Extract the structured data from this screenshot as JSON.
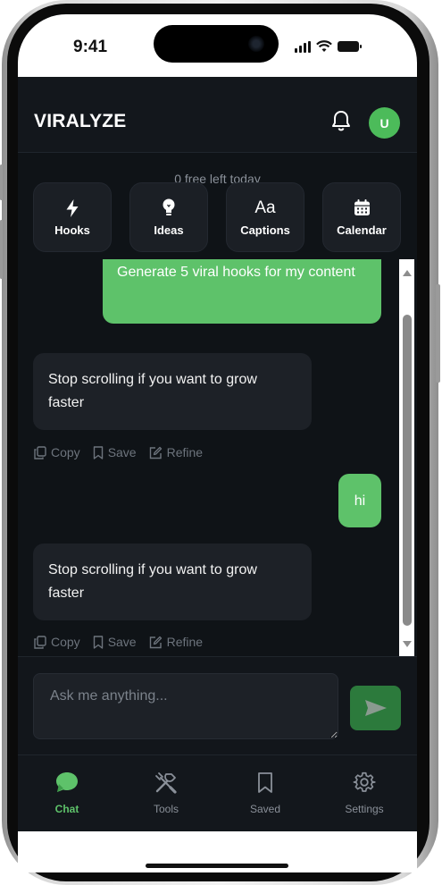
{
  "status_bar": {
    "time": "9:41"
  },
  "header": {
    "brand": "VIRALYZE",
    "avatar_initial": "U"
  },
  "credits_text": "0 free left today",
  "quick_actions": [
    {
      "label": "Hooks",
      "icon": "lightning-icon"
    },
    {
      "label": "Ideas",
      "icon": "lightbulb-icon"
    },
    {
      "label": "Captions",
      "icon": "aa-text-icon",
      "glyph": "Aa"
    },
    {
      "label": "Calendar",
      "icon": "calendar-icon"
    }
  ],
  "messages": [
    {
      "role": "user",
      "text": "Generate 5 viral hooks for my content"
    },
    {
      "role": "assistant",
      "text": "Stop scrolling if you want to grow faster"
    },
    {
      "role": "user",
      "text": "hi"
    },
    {
      "role": "assistant",
      "text": "Stop scrolling if you want to grow faster"
    }
  ],
  "message_actions": {
    "copy": "Copy",
    "save": "Save",
    "refine": "Refine"
  },
  "composer": {
    "placeholder": "Ask me anything..."
  },
  "bottom_nav": [
    {
      "label": "Chat",
      "icon": "chat-bubble-icon",
      "active": true
    },
    {
      "label": "Tools",
      "icon": "tools-icon",
      "active": false
    },
    {
      "label": "Saved",
      "icon": "bookmark-icon",
      "active": false
    },
    {
      "label": "Settings",
      "icon": "gear-icon",
      "active": false
    }
  ],
  "colors": {
    "accent": "#5ec26a",
    "background": "#0f1317",
    "bubble_bot": "#1d2127",
    "send_button": "#2c7a3c"
  }
}
